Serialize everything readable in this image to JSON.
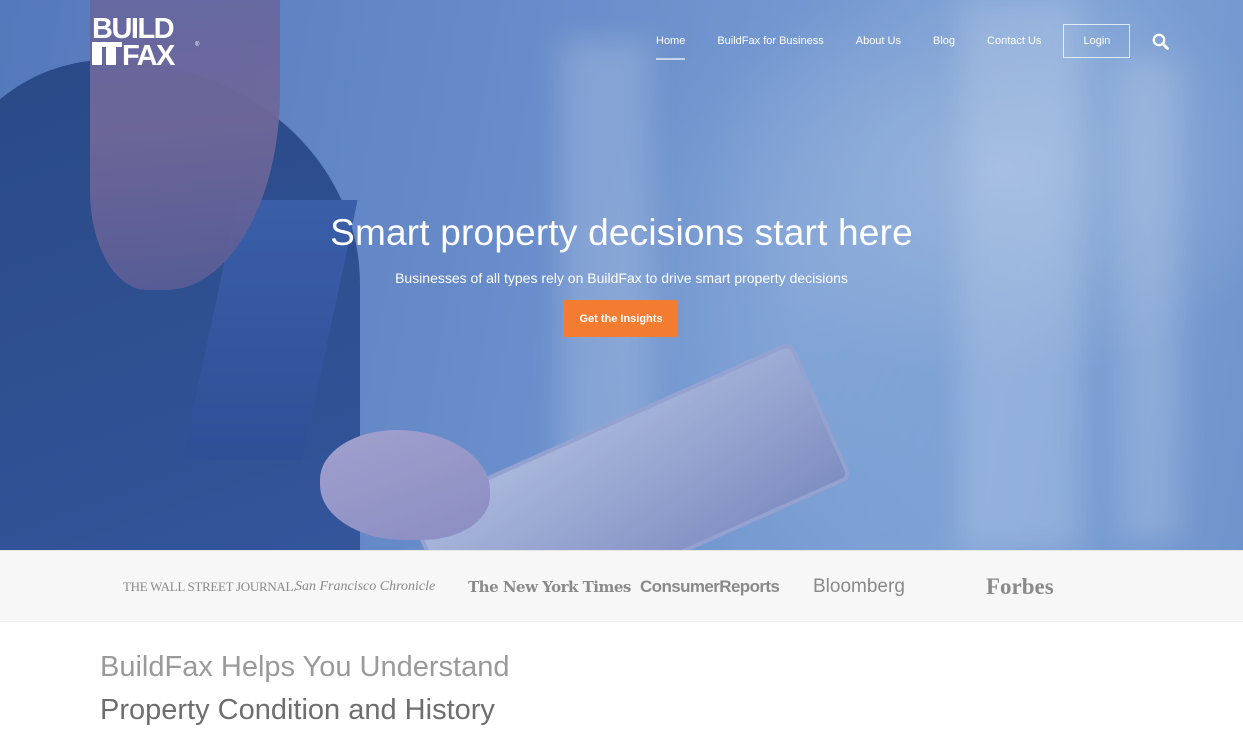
{
  "brand": {
    "logo_text_top": "BUILD",
    "logo_text_bottom": "FAX"
  },
  "nav": {
    "items": [
      {
        "label": "Home",
        "active": true
      },
      {
        "label": "BuildFax for Business",
        "active": false
      },
      {
        "label": "About Us",
        "active": false
      },
      {
        "label": "Blog",
        "active": false
      },
      {
        "label": "Contact Us",
        "active": false
      }
    ],
    "login_label": "Login",
    "search_icon": "search-icon"
  },
  "hero": {
    "title": "Smart property decisions start here",
    "subtitle": "Businesses of all types rely on BuildFax to drive smart property decisions",
    "cta_label": "Get the Insights"
  },
  "press": {
    "logos": [
      "THE WALL STREET JOURNAL.",
      "San Francisco Chronicle",
      "The New York Times",
      "ConsumerReports",
      "Bloomberg",
      "Forbes"
    ]
  },
  "intro": {
    "line1": "BuildFax Helps You Understand",
    "line2": "Property Condition and History"
  },
  "colors": {
    "accent": "#f47c30",
    "hero_tint": "#5a7fc0"
  }
}
